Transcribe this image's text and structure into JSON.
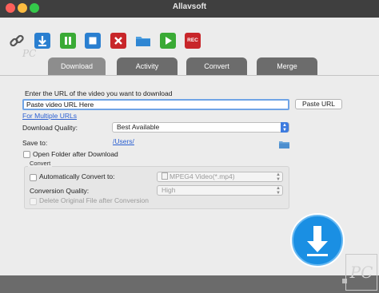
{
  "window": {
    "title": "Allavsoft"
  },
  "watermark": {
    "brand_text": "PC"
  },
  "toolbar": {
    "buttons": [
      {
        "icon": "link-icon",
        "label": ""
      },
      {
        "icon": "download-icon",
        "label": ""
      },
      {
        "icon": "pause-icon",
        "label": ""
      },
      {
        "icon": "stop-icon",
        "label": ""
      },
      {
        "icon": "delete-icon",
        "label": ""
      },
      {
        "icon": "folder-icon",
        "label": ""
      },
      {
        "icon": "play-icon",
        "label": ""
      },
      {
        "icon": "record-icon",
        "label": "REC"
      }
    ]
  },
  "tabs": [
    {
      "label": "Download",
      "active": true
    },
    {
      "label": "Activity",
      "active": false
    },
    {
      "label": "Convert",
      "active": false
    },
    {
      "label": "Merge",
      "active": false
    }
  ],
  "download": {
    "url_prompt": "Enter the URL of the video you want to download",
    "url_value": "Paste video URL Here",
    "paste_button": "Paste URL",
    "multiple_urls_link": "For Multiple URLs",
    "quality_label": "Download Quality:",
    "quality_value": "Best Available",
    "save_to_label": "Save to:",
    "save_to_path": "/Users/",
    "open_folder_label": "Open Folder after Download"
  },
  "convert": {
    "group_title": "Convert",
    "auto_convert_label": "Automatically Convert to:",
    "format_value": "MPEG4 Video(*.mp4)",
    "quality_label": "Conversion Quality:",
    "quality_value": "High",
    "delete_original_label": "Delete Original File after Conversion"
  },
  "colors": {
    "accent": "#3d7bdf",
    "title_bar": "#3f3f3f",
    "tab": "#6c6c6c",
    "status_bar": "#6b6b6b"
  }
}
